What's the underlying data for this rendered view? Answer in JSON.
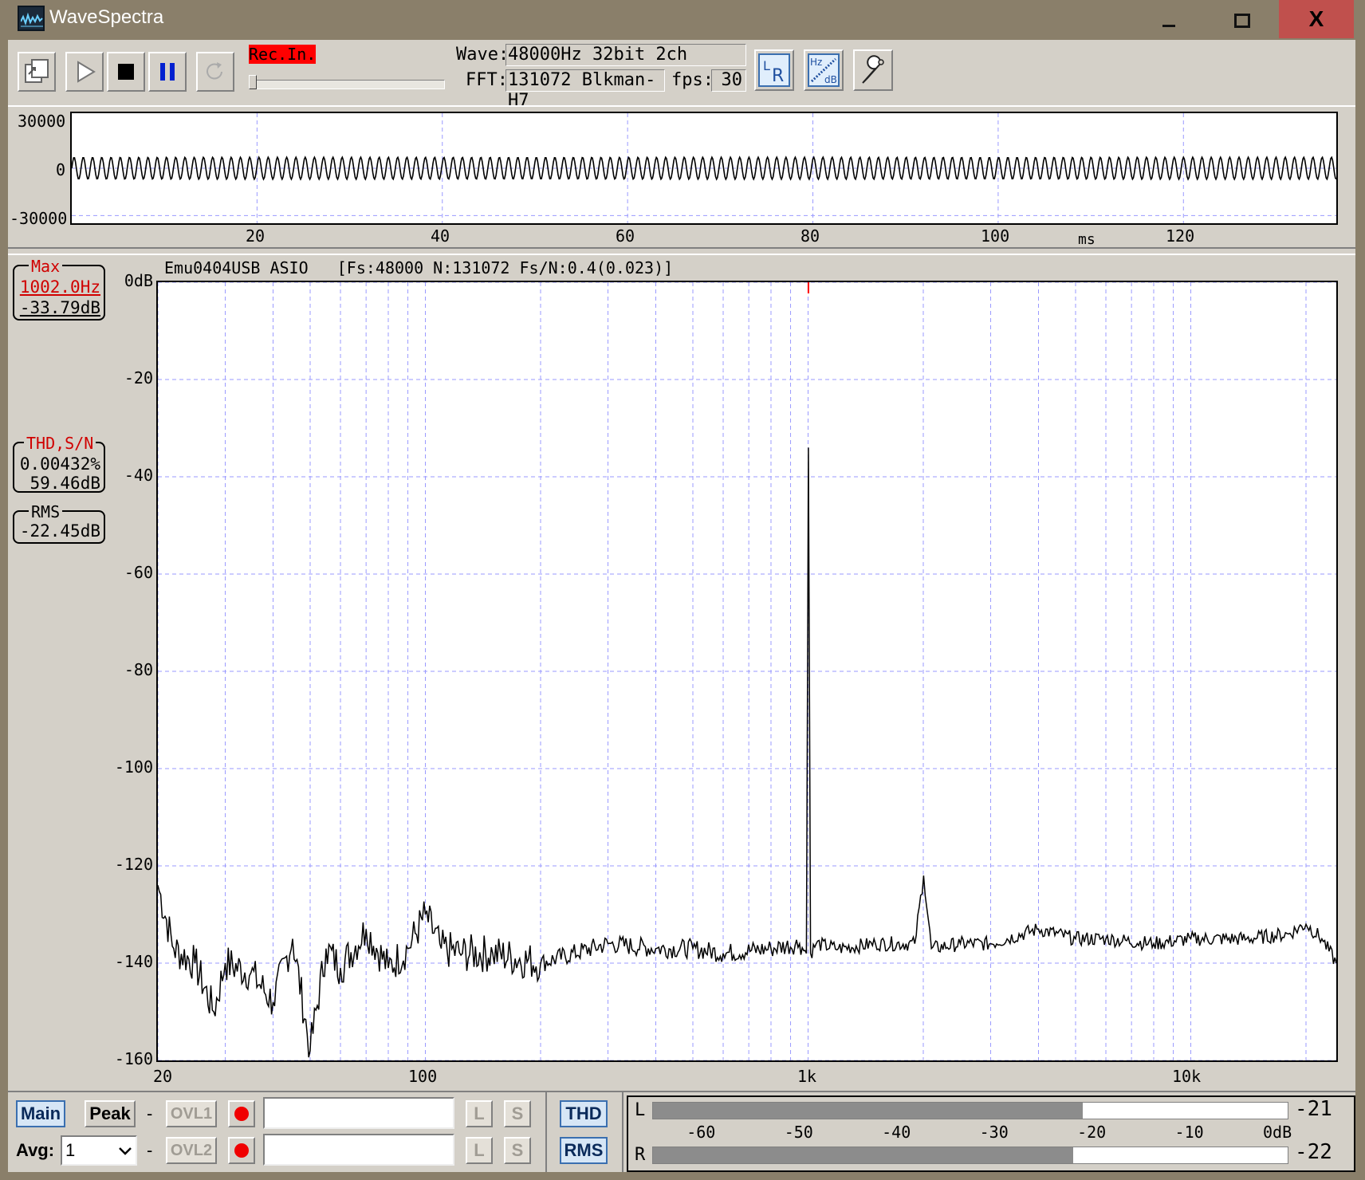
{
  "window": {
    "title": "WaveSpectra",
    "minimize_icon": "minimize-icon",
    "maximize_icon": "maximize-icon",
    "close_glyph": "X"
  },
  "toolbar": {
    "rec_indicator": "Rec.In.",
    "wave_label": "Wave:",
    "wave_value": "48000Hz 32bit 2ch",
    "fft_label": "FFT:",
    "fft_value": "131072 Blkman-H7",
    "fps_label": "fps:",
    "fps_value": "30",
    "lr_button": "LR",
    "hz_db_button": "Hz dB",
    "settings_icon": "wrench-icon"
  },
  "waveform": {
    "y_ticks": [
      "30000",
      "0",
      "-30000"
    ],
    "x_ticks": [
      "20",
      "40",
      "60",
      "80",
      "100",
      "120"
    ],
    "x_unit": "ms"
  },
  "spectrum": {
    "header": "Emu0404USB ASIO   [Fs:48000 N:131072 Fs/N:0.4(0.023)]",
    "y_ticks": [
      "0dB",
      "-20",
      "-40",
      "-60",
      "-80",
      "-100",
      "-120",
      "-140",
      "-160"
    ],
    "x_ticks": [
      "20",
      "100",
      "1k",
      "10k"
    ]
  },
  "readouts": {
    "max": {
      "title": "Max",
      "freq": "1002.0Hz",
      "level": "-33.79dB"
    },
    "thd": {
      "title": "THD,S/N",
      "thd": "0.00432%",
      "sn": "59.46dB"
    },
    "rms": {
      "title": "RMS",
      "value": "-22.45dB"
    }
  },
  "bottom": {
    "main": "Main",
    "peak": "Peak",
    "dash": "-",
    "ovl1": "OVL1",
    "ovl2": "OVL2",
    "avg_label": "Avg:",
    "avg_value": "1",
    "l": "L",
    "s": "S",
    "thd": "THD",
    "rms": "RMS",
    "meter_l_label": "L",
    "meter_r_label": "R",
    "meter_scale": [
      "-60",
      "-50",
      "-40",
      "-30",
      "-20",
      "-10",
      "0dB"
    ],
    "meter_l_value": "-21",
    "meter_r_value": "-22",
    "meter_l_level_db": -21,
    "meter_r_level_db": -22
  },
  "chart_data": [
    {
      "type": "line",
      "title": "",
      "xlabel": "ms",
      "ylabel": "",
      "xlim": [
        0,
        136.5
      ],
      "ylim": [
        -30000,
        30000
      ],
      "x_ticks": [
        20,
        40,
        60,
        80,
        100,
        120
      ],
      "y_ticks": [
        30000,
        0,
        -30000
      ],
      "grid": true,
      "series": [
        {
          "frequency_hz": 1002,
          "amplitude_approx": 600,
          "offset": 0
        }
      ]
    },
    {
      "type": "line",
      "title": "Emu0404USB ASIO   [Fs:48000 N:131072 Fs/N:0.4(0.023)]",
      "xlabel": "",
      "ylabel": "",
      "x_scale": "log",
      "xlim": [
        20,
        24000
      ],
      "ylim": [
        -160,
        0
      ],
      "x_ticks": [
        "20",
        "100",
        "1k",
        "10k"
      ],
      "y_ticks": [
        0,
        -20,
        -40,
        -60,
        -80,
        -100,
        -120,
        -140,
        -160
      ],
      "grid": true,
      "marker_hz": 1002,
      "series": [
        {
          "x": [
            20,
            22,
            25,
            28,
            30,
            35,
            40,
            45,
            50,
            55,
            60,
            70,
            80,
            90,
            100,
            110,
            125,
            150,
            200,
            300,
            400,
            500,
            600,
            800,
            950,
            990,
            1002,
            1015,
            1050,
            1200,
            1500,
            1900,
            2004,
            2100,
            2500,
            3000,
            4000,
            5000,
            6000,
            8000,
            10000,
            14000,
            18000,
            20000,
            22000,
            24000
          ],
          "y": [
            -124,
            -137,
            -140,
            -150,
            -140,
            -142,
            -148,
            -135,
            -158,
            -137,
            -141,
            -133,
            -141,
            -137,
            -130,
            -137,
            -138,
            -138,
            -140,
            -136,
            -137,
            -137,
            -138,
            -137,
            -136,
            -138,
            -34,
            -138,
            -136,
            -137,
            -136,
            -136,
            -122,
            -137,
            -136,
            -136,
            -133,
            -135,
            -135,
            -136,
            -135,
            -135,
            -134,
            -132,
            -135,
            -140
          ]
        }
      ]
    }
  ]
}
